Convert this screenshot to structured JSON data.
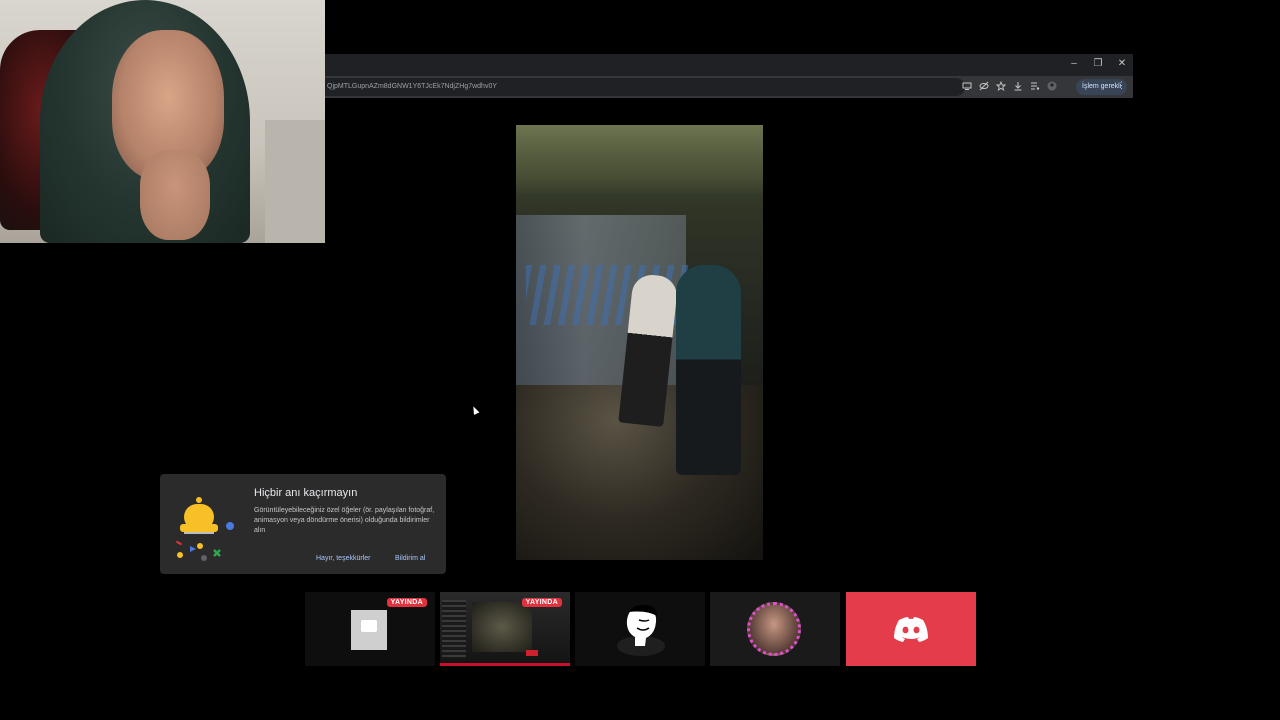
{
  "browser": {
    "url": "QjpMTLGupnAZm8dGNW1Y6TJcEk7NdjZHg7wdhv0Y",
    "window_controls": [
      "–",
      "❐",
      "✕"
    ],
    "action_chip": "İşlem gerekli",
    "menu": "⋮",
    "icons": [
      "screen-share-icon",
      "eye-off-icon",
      "star-icon",
      "download-icon",
      "media-control-icon",
      "profile-icon"
    ]
  },
  "notification": {
    "title": "Hiçbir anı kaçırmayın",
    "body": "Görüntüleyebileceğiniz özel öğeler (ör. paylaşılan fotoğraf, animasyon veya döndürme önerisi) olduğunda bildirimler alın",
    "dismiss_label": "Hayır, teşekkürler",
    "accept_label": "Bildirim al"
  },
  "tiles": [
    {
      "name": "stream-tile-1",
      "badge": "YAYINDA"
    },
    {
      "name": "stream-tile-2",
      "badge": "YAYINDA"
    },
    {
      "name": "avatar-tile-3",
      "badge": ""
    },
    {
      "name": "avatar-tile-4",
      "badge": ""
    },
    {
      "name": "discord-tile",
      "badge": ""
    }
  ],
  "colors": {
    "live_badge": "#e0323f",
    "discord": "#e43c4a",
    "accent_link": "#a8c7fa"
  }
}
